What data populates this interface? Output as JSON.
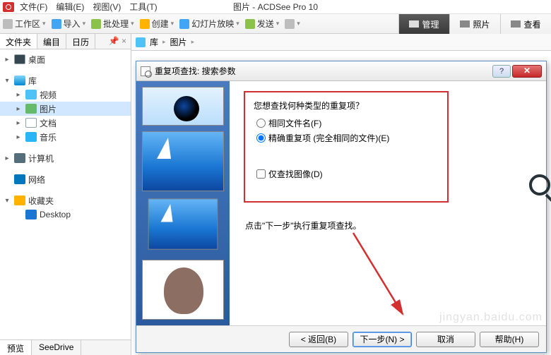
{
  "app": {
    "title": "图片 - ACDSee Pro 10"
  },
  "menu": {
    "file": "文件(F)",
    "edit": "编辑(E)",
    "view": "视图(V)",
    "tools": "工具(T)"
  },
  "toolbar": {
    "workspace": "工作区",
    "import": "导入",
    "batch": "批处理",
    "create": "创建",
    "slideshow": "幻灯片放映",
    "send": "发送"
  },
  "modes": {
    "manage": "管理",
    "photo": "照片",
    "viewmode": "查看"
  },
  "sidebar": {
    "tabs": {
      "folders": "文件夹",
      "catalog": "编目",
      "calendar": "日历"
    },
    "desktop": "桌面",
    "library": "库",
    "video": "视频",
    "pictures": "图片",
    "documents": "文档",
    "music": "音乐",
    "computer": "计算机",
    "network": "网络",
    "favorites": "收藏夹",
    "desktop2": "Desktop",
    "bottom": {
      "preview": "预览",
      "seedrive": "SeeDrive"
    }
  },
  "breadcrumb": {
    "root": "库",
    "current": "图片"
  },
  "dialog": {
    "title": "重复项查找: 搜索参数",
    "question": "您想查找何种类型的重复项？",
    "radio_same_name": "相同文件名(F)",
    "radio_exact": "精确重复项 (完全相同的文件)(E)",
    "check_images_only": "仅查找图像(D)",
    "hint": "点击\"下一步\"执行重复项查找。",
    "btn_back": "< 返回(B)",
    "btn_next": "下一步(N) >",
    "btn_cancel": "取消",
    "btn_help": "帮助(H)",
    "help_q": "?"
  },
  "watermark": "jingyan.baidu.com"
}
